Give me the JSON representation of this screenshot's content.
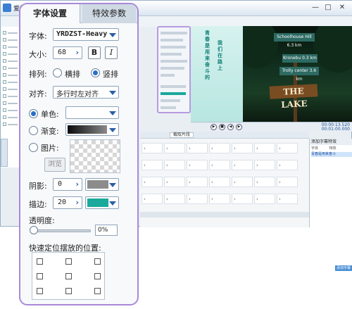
{
  "app": {
    "title": "爱剪辑",
    "minimize_glyph": "—",
    "maximize_glyph": "□",
    "close_glyph": "✕"
  },
  "font_panel": {
    "tabs": [
      "字体设置",
      "特效参数"
    ],
    "font_label": "字体:",
    "font_value": "YRDZST-Heavy",
    "size_label": "大小:",
    "size_value": "68",
    "bold_glyph": "B",
    "italic_glyph": "I",
    "layout_label": "排列:",
    "layout_horizontal": "横排",
    "layout_vertical": "竖排",
    "layout_selected": "竖排",
    "align_label": "对齐:",
    "align_value": "多行时左对齐",
    "fill_options": {
      "solid_label": "单色:",
      "gradient_label": "渐变:",
      "image_label": "图片:",
      "selected": "单色"
    },
    "solid_color": "#ffffff",
    "gradient_colors": [
      "#0a0a0a",
      "#8a8a8a"
    ],
    "browse_label": "浏览",
    "shadow_label": "阴影:",
    "shadow_value": "0",
    "shadow_color": "#8c8c8c",
    "stroke_label": "描边:",
    "stroke_value": "20",
    "stroke_color": "#1aa99b",
    "opacity_label": "透明度:",
    "opacity_value": "0%",
    "position_label": "快速定位摆放的位置:"
  },
  "preview": {
    "text_columns": [
      "青春是用来奋斗的",
      "我们在路上"
    ],
    "signs": [
      "Schoolhouse Hill 6.3 km",
      "Kronebu 0.3 km",
      "Trolly center 3.6 km"
    ],
    "lake_sign": "THE LAKE",
    "time_current": "00:00:13.520",
    "time_total": "00:01:00.000"
  },
  "timeline": {
    "button_label": "截取片段"
  },
  "right_panel": {
    "header": "添加字幕特效",
    "columns": [
      "字体",
      "特效"
    ],
    "first_row": "青春是用来奋斗",
    "add_button": "添加字幕"
  }
}
